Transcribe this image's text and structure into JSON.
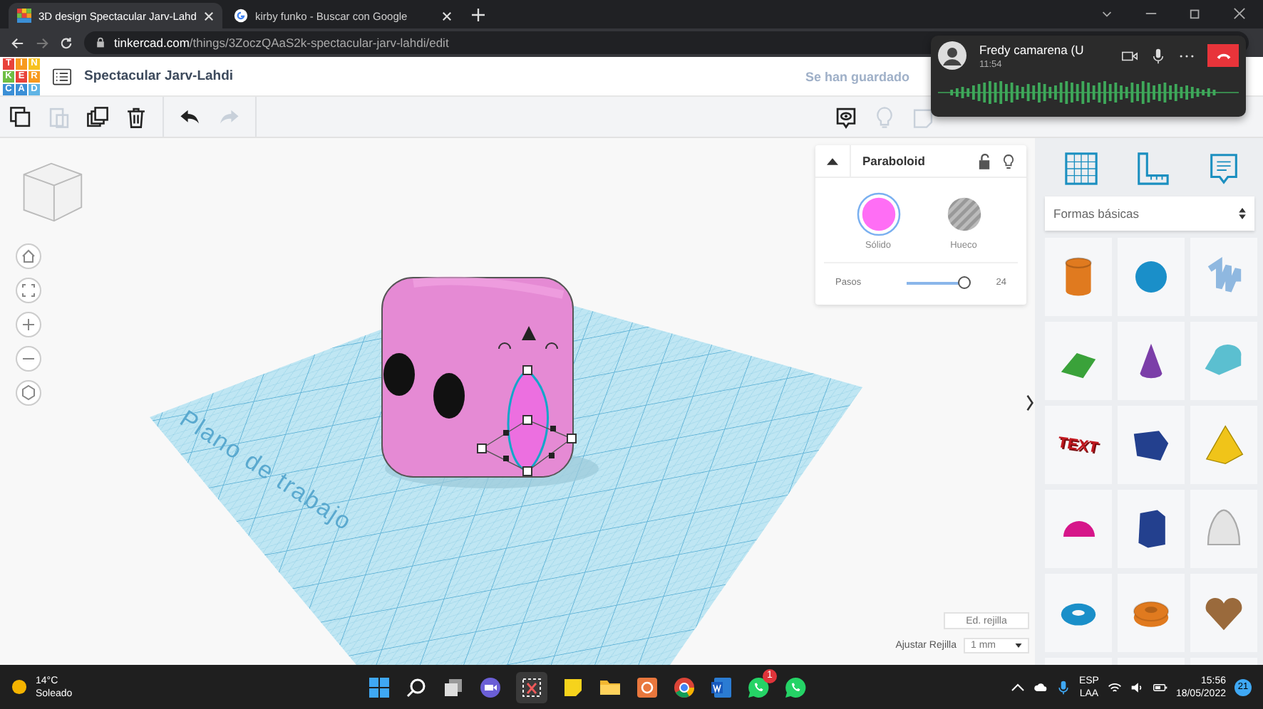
{
  "browser": {
    "tabs": [
      {
        "title": "3D design Spectacular Jarv-Lahd",
        "selected": true,
        "kind": "tinkercad"
      },
      {
        "title": "kirby funko - Buscar con Google",
        "selected": false,
        "kind": "google"
      }
    ],
    "address": {
      "host": "tinkercad.com",
      "path": "/things/3ZoczQAaS2k-spectacular-jarv-lahdi/edit"
    }
  },
  "header": {
    "logo_letters": [
      {
        "letter": "T",
        "color": "#e8423b"
      },
      {
        "letter": "I",
        "color": "#f79a1f"
      },
      {
        "letter": "N",
        "color": "#f7c21f"
      },
      {
        "letter": "K",
        "color": "#6fbe44"
      },
      {
        "letter": "E",
        "color": "#e8423b"
      },
      {
        "letter": "R",
        "color": "#f79a1f"
      },
      {
        "letter": "C",
        "color": "#3b8fd6"
      },
      {
        "letter": "A",
        "color": "#3b8fd6"
      },
      {
        "letter": "D",
        "color": "#5fb4e5"
      }
    ],
    "design_title": "Spectacular Jarv-Lahdi",
    "save_status": "Se han guardado"
  },
  "toolbar": {
    "tools": [
      {
        "kind": "copy",
        "disabled": false
      },
      {
        "kind": "paste",
        "disabled": true
      },
      {
        "kind": "duplicate",
        "disabled": false
      },
      {
        "kind": "delete",
        "disabled": false
      },
      {
        "kind": "undo",
        "disabled": false
      },
      {
        "kind": "redo",
        "disabled": true
      }
    ]
  },
  "workplane": {
    "label": "Plano de trabajo"
  },
  "inspector": {
    "title": "Paraboloid",
    "options": [
      {
        "label": "Sólido",
        "selected": true,
        "kind": "solid"
      },
      {
        "label": "Hueco",
        "selected": false,
        "kind": "hole"
      }
    ],
    "slider": {
      "label": "Pasos",
      "level": 0.95,
      "reading": "24"
    }
  },
  "shapes_panel": {
    "category": "Formas básicas",
    "shapes": [
      {
        "kind": "cylinder",
        "color": "#e07a1f"
      },
      {
        "kind": "sphere",
        "color": "#1a8fc9"
      },
      {
        "kind": "scribble",
        "color": "#8fb8e0"
      },
      {
        "kind": "roof",
        "color": "#3aa23a"
      },
      {
        "kind": "cone",
        "color": "#7b3ea8"
      },
      {
        "kind": "round-roof",
        "color": "#5bbfd0"
      },
      {
        "kind": "text",
        "color": "#c2181f",
        "label": "TEXT"
      },
      {
        "kind": "box",
        "color": "#23408e"
      },
      {
        "kind": "pyramid",
        "color": "#f0c419"
      },
      {
        "kind": "half-sphere",
        "color": "#d6168a"
      },
      {
        "kind": "prism",
        "color": "#23408e"
      },
      {
        "kind": "paraboloid",
        "color": "#e4e4e4"
      },
      {
        "kind": "torus",
        "color": "#1a8fc9"
      },
      {
        "kind": "tube",
        "color": "#e07a1f"
      },
      {
        "kind": "heart",
        "color": "#9a6a3c"
      }
    ]
  },
  "grid_controls": {
    "edit_button": "Ed. rejilla",
    "snap_label": "Ajustar Rejilla",
    "snap_value": "1 mm"
  },
  "call": {
    "name": "Fredy camarena (U",
    "time": "11:54"
  },
  "taskbar": {
    "weather_temp": "14°C",
    "weather_text": "Soleado",
    "whatsapp_badge": "1",
    "language": "ESP",
    "layout": "LAA",
    "time": "15:56",
    "date": "18/05/2022",
    "notifications": "21"
  }
}
